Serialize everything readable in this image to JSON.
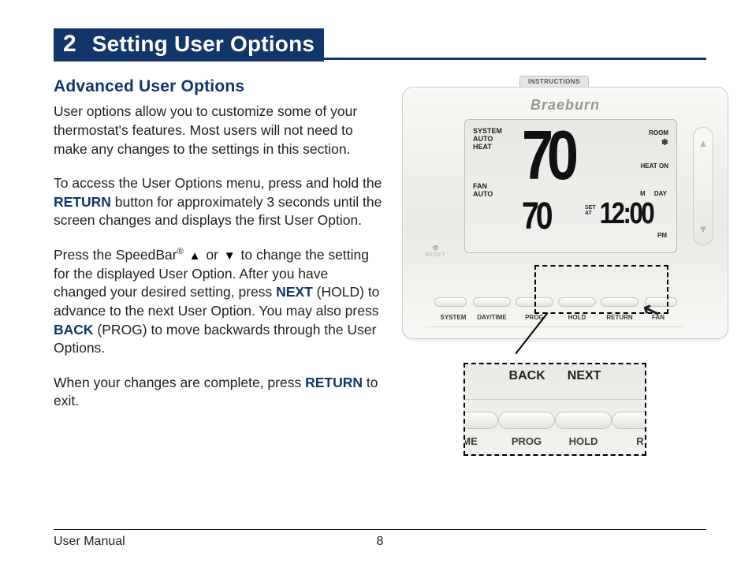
{
  "header": {
    "number": "2",
    "title": "Setting User Options"
  },
  "section": {
    "heading": "Advanced User Options",
    "p1": "User options allow you to customize some of your thermostat's features. Most users will not need to make any changes to the settings in this section.",
    "p2a": "To access the User Options menu, press and hold the ",
    "p2_return": "RETURN",
    "p2b": " button for approximately 3 seconds until the screen changes and displays the first User Option.",
    "p3a": "Press the SpeedBar",
    "p3reg": "®",
    "p3b": " or ",
    "p3c": " to change the setting for the displayed User Option. After you have changed your desired setting, press ",
    "p3_next": "NEXT",
    "p3d": " (HOLD) to advance to the next User Option. You may also press ",
    "p3_back": "BACK",
    "p3e": " (PROG) to move backwards through the User Options.",
    "p4a": "When your changes are complete, press ",
    "p4_return": "RETURN",
    "p4b": " to exit."
  },
  "thermo": {
    "instructions_tab": "INSTRUCTIONS",
    "brand": "Braeburn",
    "reset": "RESET",
    "system_label": "SYSTEM",
    "system_mode1": "AUTO",
    "system_mode2": "HEAT",
    "fan_label": "FAN",
    "fan_mode": "AUTO",
    "big_temp": "70",
    "small_temp": "70",
    "room": "ROOM",
    "heat_on": "HEAT ON",
    "setat1": "SET",
    "setat2": "AT",
    "m": "M",
    "day": "DAY",
    "clock": "12:00",
    "pm": "PM",
    "buttons": {
      "system": "SYSTEM",
      "daytime": "DAY/TIME",
      "prog": "PROG",
      "hold": "HOLD",
      "return": "RETURN",
      "fan": "FAN"
    },
    "zoom": {
      "back": "BACK",
      "next": "NEXT",
      "me": "ME",
      "prog": "PROG",
      "hold": "HOLD",
      "r": "R"
    }
  },
  "footer": {
    "left": "User Manual",
    "page": "8"
  }
}
